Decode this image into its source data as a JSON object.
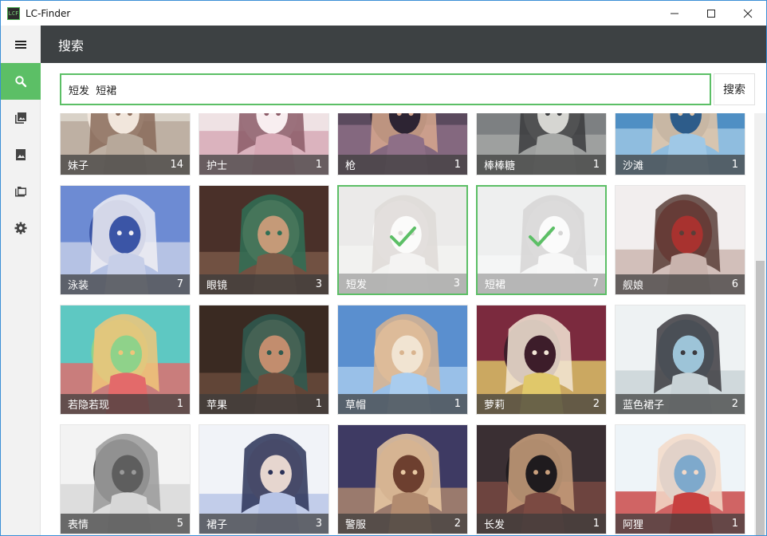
{
  "window": {
    "title": "LC-Finder",
    "app_icon_text": "LCF"
  },
  "window_controls": [
    "minimize",
    "maximize",
    "close"
  ],
  "nav": {
    "items": [
      {
        "icon": "menu-icon",
        "active": false
      },
      {
        "icon": "search-icon",
        "active": true
      },
      {
        "icon": "photo-library-icon",
        "active": false
      },
      {
        "icon": "photo-icon",
        "active": false
      },
      {
        "icon": "folder-icon",
        "active": false
      },
      {
        "icon": "gear-icon",
        "active": false
      }
    ]
  },
  "header": {
    "title": "搜索"
  },
  "search": {
    "value": "短发  短裙",
    "button_label": "搜索"
  },
  "accent_color": "#5cbf66",
  "tags": [
    {
      "name": "妹子",
      "count": "14",
      "selected": false
    },
    {
      "name": "护士",
      "count": "1",
      "selected": false
    },
    {
      "name": "枪",
      "count": "1",
      "selected": false
    },
    {
      "name": "棒棒糖",
      "count": "1",
      "selected": false
    },
    {
      "name": "沙滩",
      "count": "1",
      "selected": false
    },
    {
      "name": "泳装",
      "count": "7",
      "selected": false
    },
    {
      "name": "眼镜",
      "count": "3",
      "selected": false
    },
    {
      "name": "短发",
      "count": "3",
      "selected": true
    },
    {
      "name": "短裙",
      "count": "7",
      "selected": true
    },
    {
      "name": "舰娘",
      "count": "6",
      "selected": false
    },
    {
      "name": "若隐若现",
      "count": "1",
      "selected": false
    },
    {
      "name": "苹果",
      "count": "1",
      "selected": false
    },
    {
      "name": "草帽",
      "count": "1",
      "selected": false
    },
    {
      "name": "萝莉",
      "count": "2",
      "selected": false
    },
    {
      "name": "蓝色裙子",
      "count": "2",
      "selected": false
    },
    {
      "name": "表情",
      "count": "5",
      "selected": false
    },
    {
      "name": "裙子",
      "count": "3",
      "selected": false
    },
    {
      "name": "警服",
      "count": "2",
      "selected": false
    },
    {
      "name": "长发",
      "count": "1",
      "selected": false
    },
    {
      "name": "阿狸",
      "count": "1",
      "selected": false
    }
  ]
}
